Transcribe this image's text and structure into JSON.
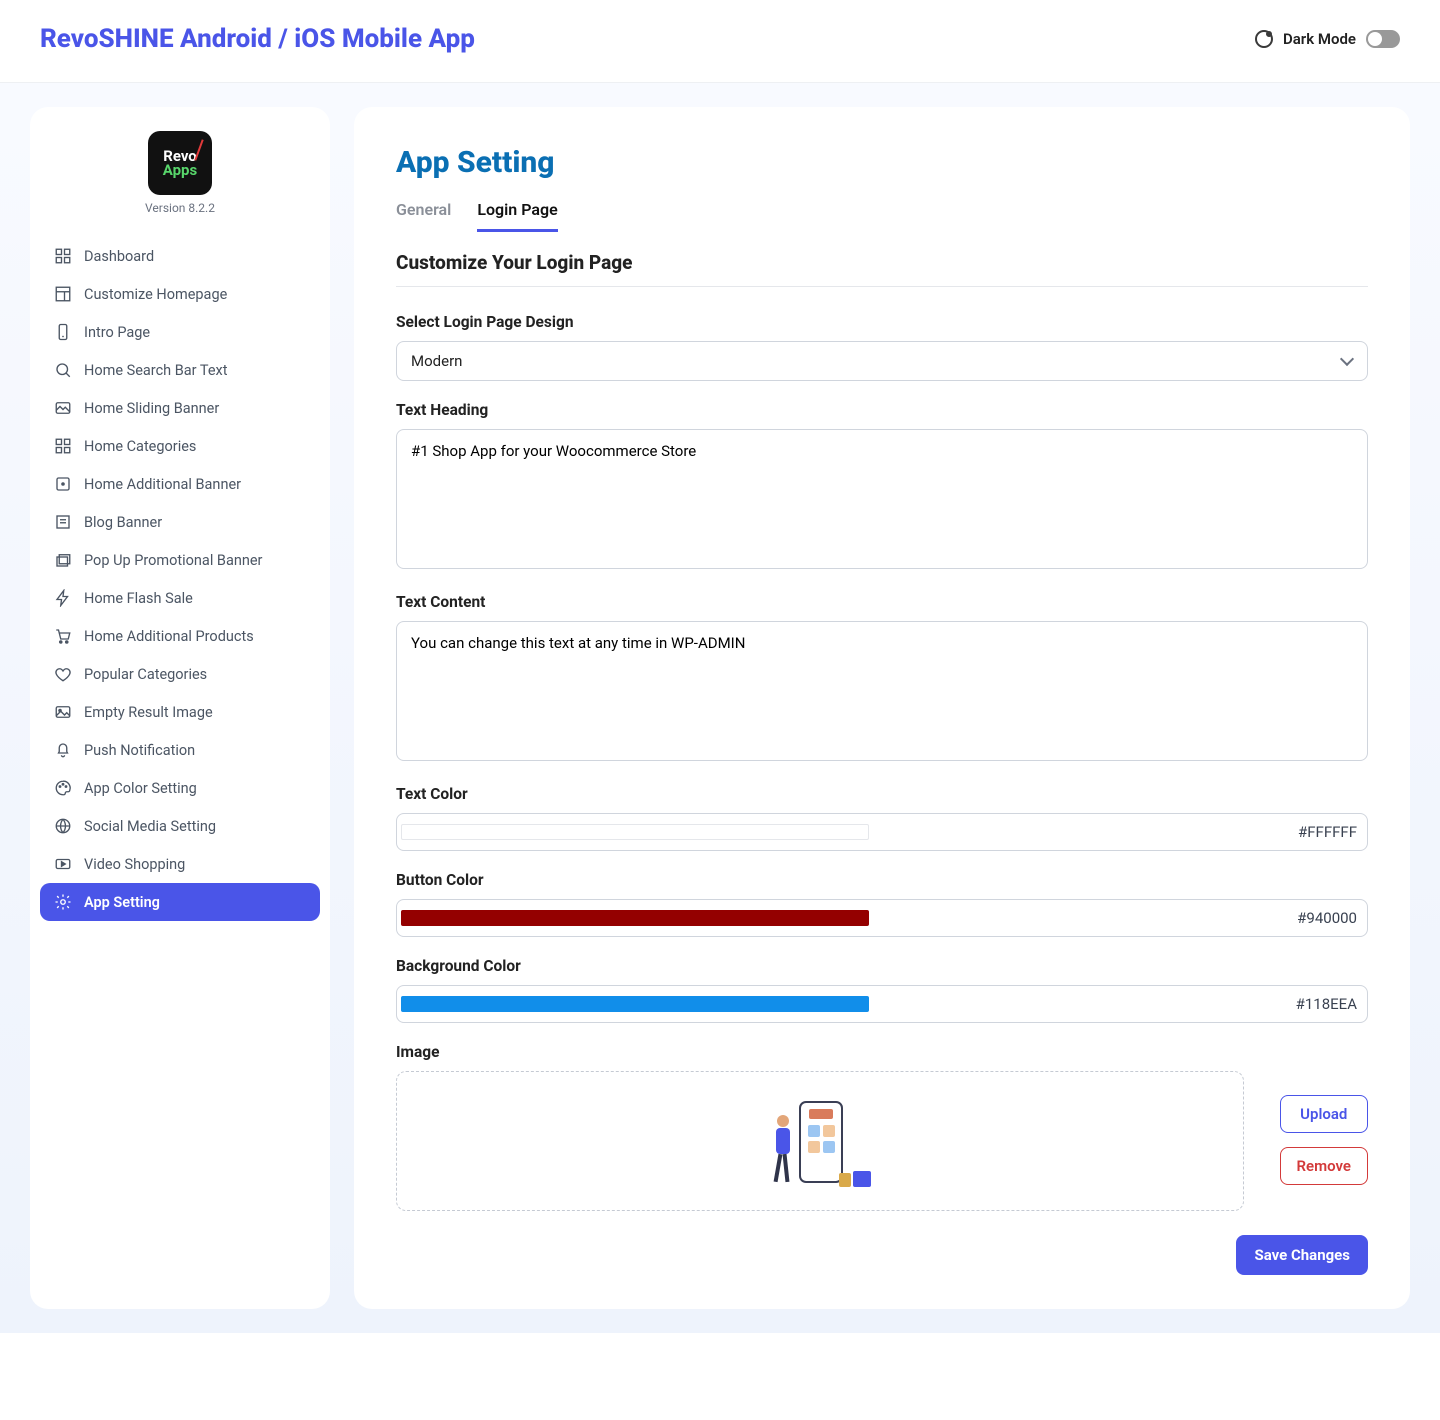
{
  "header": {
    "title": "RevoSHINE Android / iOS Mobile App",
    "dark_mode_label": "Dark Mode"
  },
  "logo": {
    "line1": "Revo",
    "line2": "Apps",
    "version": "Version 8.2.2"
  },
  "sidebar": {
    "items": [
      {
        "label": "Dashboard",
        "icon": "grid-icon"
      },
      {
        "label": "Customize Homepage",
        "icon": "layout-icon"
      },
      {
        "label": "Intro Page",
        "icon": "phone-icon"
      },
      {
        "label": "Home Search Bar Text",
        "icon": "search-icon"
      },
      {
        "label": "Home Sliding Banner",
        "icon": "image-icon"
      },
      {
        "label": "Home Categories",
        "icon": "grid-icon"
      },
      {
        "label": "Home Additional Banner",
        "icon": "square-icon"
      },
      {
        "label": "Blog Banner",
        "icon": "article-icon"
      },
      {
        "label": "Pop Up Promotional Banner",
        "icon": "stack-icon"
      },
      {
        "label": "Home Flash Sale",
        "icon": "bolt-icon"
      },
      {
        "label": "Home Additional Products",
        "icon": "cart-icon"
      },
      {
        "label": "Popular Categories",
        "icon": "heart-icon"
      },
      {
        "label": "Empty Result Image",
        "icon": "picture-icon"
      },
      {
        "label": "Push Notification",
        "icon": "bell-icon"
      },
      {
        "label": "App Color Setting",
        "icon": "palette-icon"
      },
      {
        "label": "Social Media Setting",
        "icon": "globe-icon"
      },
      {
        "label": "Video Shopping",
        "icon": "video-icon"
      },
      {
        "label": "App Setting",
        "icon": "gear-icon",
        "active": true
      }
    ]
  },
  "main": {
    "page_title": "App Setting",
    "tabs": [
      {
        "label": "General",
        "active": false
      },
      {
        "label": "Login Page",
        "active": true
      }
    ],
    "section_title": "Customize Your Login Page",
    "select_design": {
      "label": "Select Login Page Design",
      "value": "Modern"
    },
    "text_heading": {
      "label": "Text Heading",
      "value": "#1 Shop App for your Woocommerce Store"
    },
    "text_content": {
      "label": "Text Content",
      "value": "You can change this text at any time in WP-ADMIN"
    },
    "text_color": {
      "label": "Text Color",
      "hex": "#FFFFFF",
      "swatch": "#ffffff"
    },
    "button_color": {
      "label": "Button Color",
      "hex": "#940000",
      "swatch": "#940000"
    },
    "bg_color": {
      "label": "Background Color",
      "hex": "#118EEA",
      "swatch": "#118EEA"
    },
    "image_label": "Image",
    "upload_btn": "Upload",
    "remove_btn": "Remove",
    "save_btn": "Save Changes"
  }
}
